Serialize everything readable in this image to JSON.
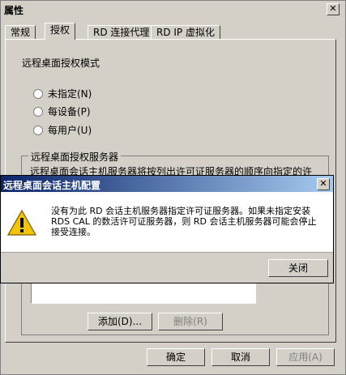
{
  "window": {
    "title": "属性",
    "close_symbol": "✕",
    "tabs": [
      "常规",
      "授权",
      "RD 连接代理",
      "RD IP 虚拟化"
    ],
    "panel": {
      "mode_label": "远程桌面授权模式",
      "options": [
        "未指定(N)",
        "每设备(P)",
        "每用户(U)"
      ],
      "group_title": "远程桌面授权服务器",
      "group_desc": "远程桌面会话主机服务器将按列出许可证服务器的顺序向指定的许",
      "add_button": "添加(D)...",
      "remove_button": "删除(R)"
    },
    "footer": {
      "ok": "确定",
      "cancel": "取消",
      "apply": "应用(A)"
    }
  },
  "dialog": {
    "title": "远程桌面会话主机配置",
    "close_symbol": "✕",
    "message": "没有为此 RD 会话主机服务器指定许可证服务器。如果未指定安装 RDS  CAL 的数活许可证服务器，则 RD 会话主机服务器可能会停止接受连接。",
    "close_button": "关闭",
    "icon": "warning-icon"
  }
}
